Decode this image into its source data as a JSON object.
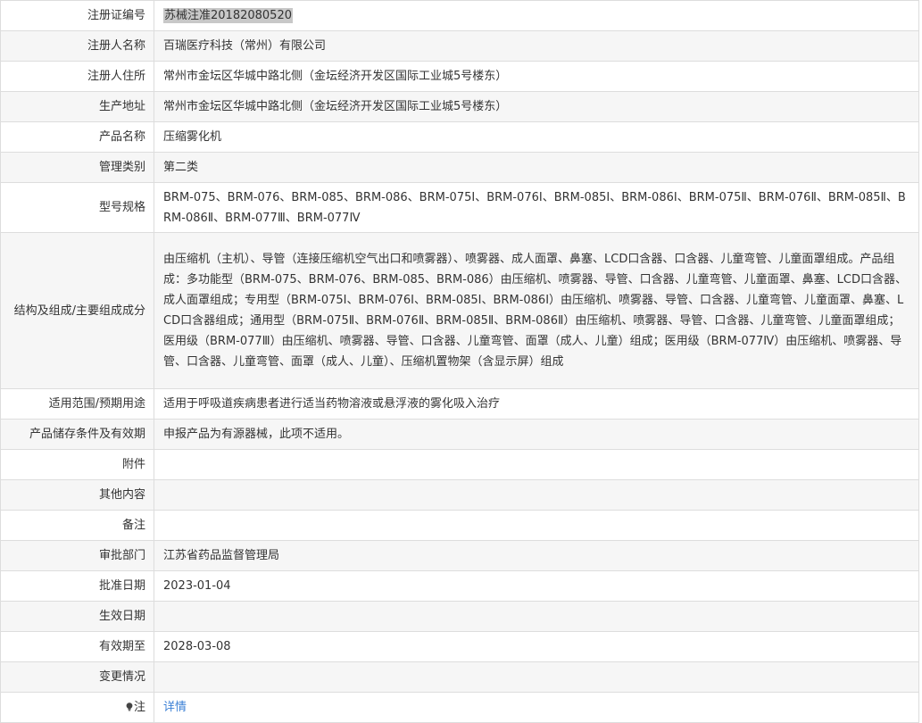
{
  "rows": [
    {
      "label": "注册证编号",
      "value": "苏械注准20182080520"
    },
    {
      "label": "注册人名称",
      "value": "百瑞医疗科技（常州）有限公司"
    },
    {
      "label": "注册人住所",
      "value": "常州市金坛区华城中路北侧（金坛经济开发区国际工业城5号楼东）"
    },
    {
      "label": "生产地址",
      "value": "常州市金坛区华城中路北侧（金坛经济开发区国际工业城5号楼东）"
    },
    {
      "label": "产品名称",
      "value": "压缩雾化机"
    },
    {
      "label": "管理类别",
      "value": "第二类"
    },
    {
      "label": "型号规格",
      "value": "BRM-075、BRM-076、BRM-085、BRM-086、BRM-075Ⅰ、BRM-076Ⅰ、BRM-085Ⅰ、BRM-086Ⅰ、BRM-075Ⅱ、BRM-076Ⅱ、BRM-085Ⅱ、BRM-086Ⅱ、BRM-077Ⅲ、BRM-077Ⅳ"
    },
    {
      "label": "结构及组成/主要组成成分",
      "value": "由压缩机（主机）、导管（连接压缩机空气出口和喷雾器）、喷雾器、成人面罩、鼻塞、LCD口含器、口含器、儿童弯管、儿童面罩组成。产品组成：多功能型（BRM-075、BRM-076、BRM-085、BRM-086）由压缩机、喷雾器、导管、口含器、儿童弯管、儿童面罩、鼻塞、LCD口含器、成人面罩组成；专用型（BRM-075Ⅰ、BRM-076Ⅰ、BRM-085Ⅰ、BRM-086Ⅰ）由压缩机、喷雾器、导管、口含器、儿童弯管、儿童面罩、鼻塞、LCD口含器组成；通用型（BRM-075Ⅱ、BRM-076Ⅱ、BRM-085Ⅱ、BRM-086Ⅱ）由压缩机、喷雾器、导管、口含器、儿童弯管、儿童面罩组成；医用级（BRM-077Ⅲ）由压缩机、喷雾器、导管、口含器、儿童弯管、面罩（成人、儿童）组成；医用级（BRM-077Ⅳ）由压缩机、喷雾器、导管、口含器、儿童弯管、面罩（成人、儿童）、压缩机置物架（含显示屏）组成"
    },
    {
      "label": "适用范围/预期用途",
      "value": "适用于呼吸道疾病患者进行适当药物溶液或悬浮液的雾化吸入治疗"
    },
    {
      "label": "产品储存条件及有效期",
      "value": "申报产品为有源器械，此项不适用。"
    },
    {
      "label": "附件",
      "value": ""
    },
    {
      "label": "其他内容",
      "value": ""
    },
    {
      "label": "备注",
      "value": ""
    },
    {
      "label": "审批部门",
      "value": "江苏省药品监督管理局"
    },
    {
      "label": "批准日期",
      "value": "2023-01-04"
    },
    {
      "label": "生效日期",
      "value": ""
    },
    {
      "label": "有效期至",
      "value": "2028-03-08"
    },
    {
      "label": "变更情况",
      "value": ""
    }
  ],
  "note_row": {
    "label": "注",
    "icon": "lightbulb-icon",
    "link_text": "详情"
  }
}
